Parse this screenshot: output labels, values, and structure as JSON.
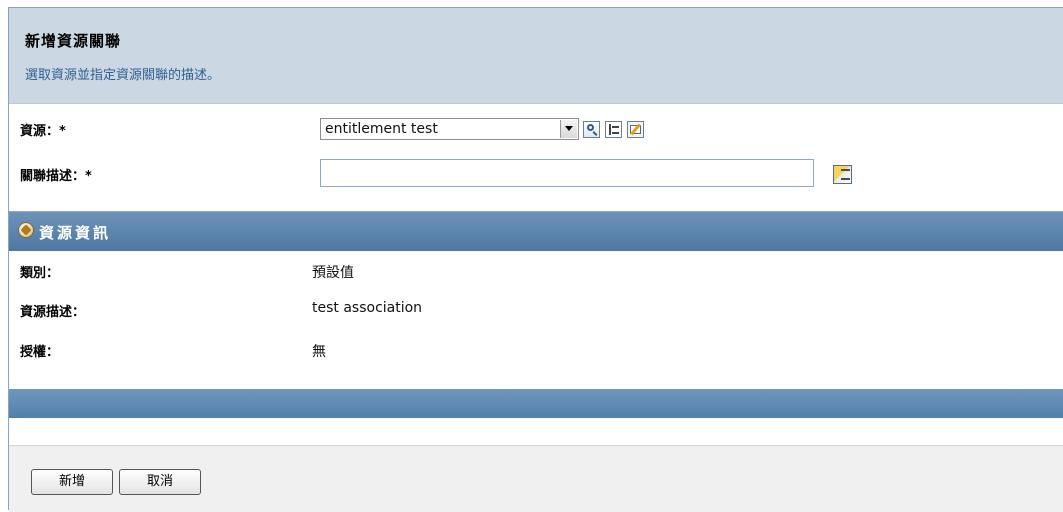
{
  "header": {
    "title": "新增資源關聯",
    "subtitle": "選取資源並指定資源關聯的描述。"
  },
  "form": {
    "resource_label": "資源：*",
    "resource_value": "entitlement test",
    "description_label": "關聯描述：*",
    "description_value": ""
  },
  "icons": {
    "search": "search-icon",
    "tree": "tree-browse-icon",
    "edit": "edit-icon",
    "language": "language-icon",
    "section": "resource-info-icon"
  },
  "resource_info": {
    "section_title": "資源資訊",
    "category_label": "類別：",
    "category_value": "預設值",
    "resource_desc_label": "資源描述：",
    "resource_desc_value": "test association",
    "entitlement_label": "授權：",
    "entitlement_value": "無"
  },
  "footer": {
    "add_label": "新增",
    "cancel_label": "取消"
  },
  "colors": {
    "header_bg": "#cbd8e4",
    "section_bar": "#4d78a3",
    "subtitle": "#2f5f8f"
  }
}
